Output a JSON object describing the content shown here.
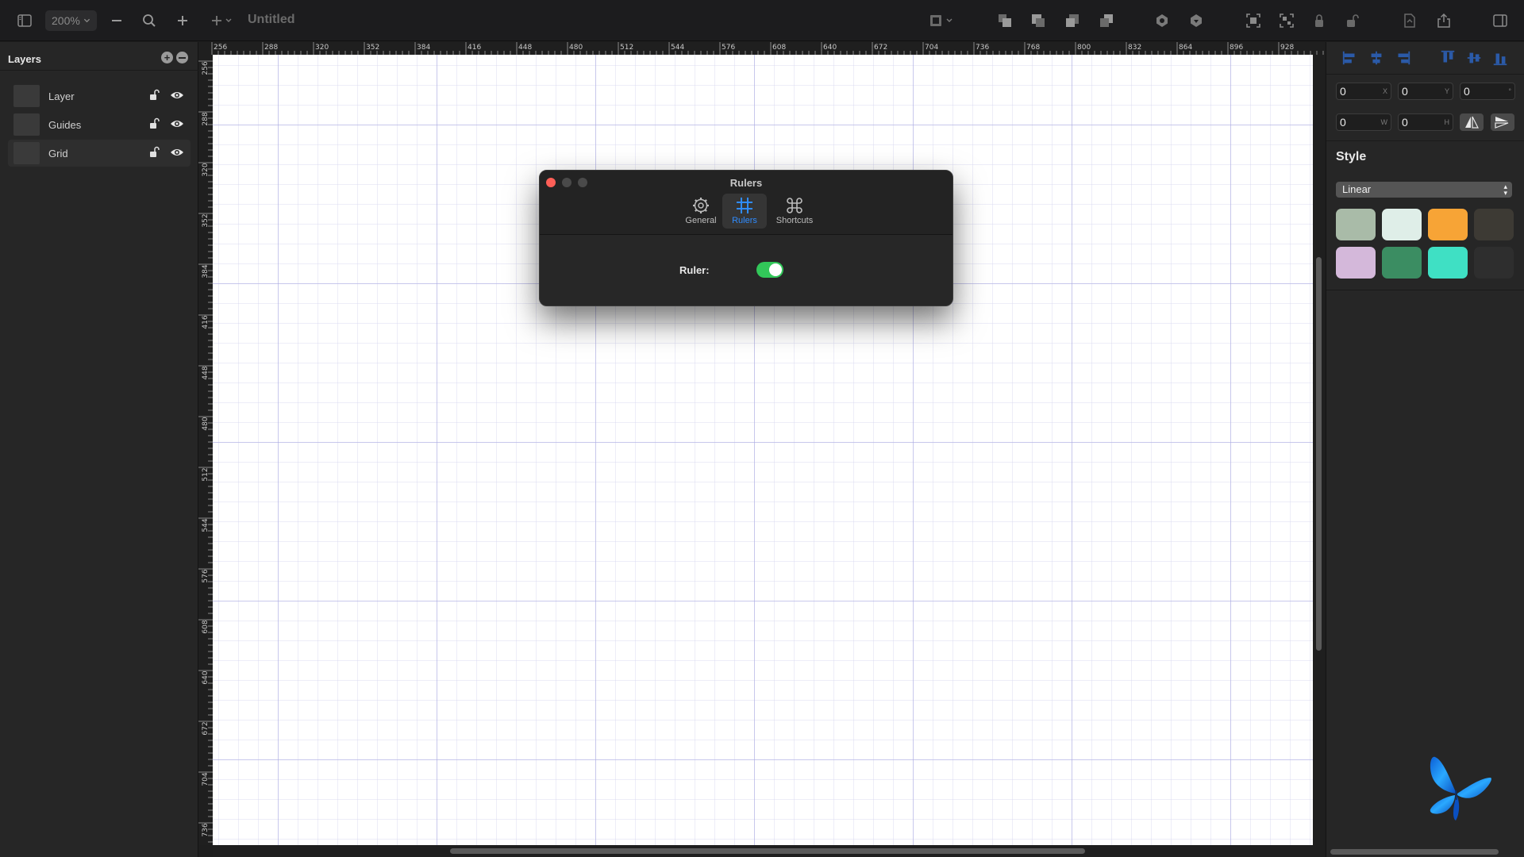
{
  "toolbar": {
    "zoom_value": "200%",
    "zoom_chevron": "⌄",
    "document_title": "Untitled",
    "icons": [
      "sidebar-left-icon",
      "zoom-out-icon",
      "magnifier-icon",
      "zoom-in-icon",
      "add-shape-icon",
      "frame-icon",
      "arrange-front-icon",
      "arrange-forward-icon",
      "arrange-backward-icon",
      "arrange-back-icon",
      "boolean-union-icon",
      "boolean-subtract-icon",
      "group-icon",
      "ungroup-icon",
      "lock-icon",
      "unlock-icon",
      "export-file-icon",
      "share-icon",
      "sidebar-right-icon"
    ]
  },
  "layers_panel": {
    "title": "Layers",
    "add_symbol": "+",
    "items": [
      {
        "name": "Layer",
        "selected": false
      },
      {
        "name": "Guides",
        "selected": false
      },
      {
        "name": "Grid",
        "selected": true
      }
    ]
  },
  "rulers": {
    "top_labels": [
      "256",
      "288",
      "320",
      "352",
      "384",
      "416",
      "448",
      "480",
      "512",
      "544",
      "576",
      "608",
      "640",
      "672",
      "704",
      "736",
      "768",
      "800",
      "832",
      "864",
      "896",
      "928"
    ],
    "left_labels": [
      "256",
      "288",
      "320",
      "352",
      "384",
      "416",
      "448",
      "480",
      "512",
      "544",
      "576",
      "608",
      "640",
      "672",
      "704",
      "736"
    ]
  },
  "dialog": {
    "title": "Rulers",
    "tabs": [
      {
        "label": "General",
        "icon": "gear-icon",
        "active": false
      },
      {
        "label": "Rulers",
        "icon": "grid-icon",
        "active": true
      },
      {
        "label": "Shortcuts",
        "icon": "command-icon",
        "active": false
      }
    ],
    "ruler_label": "Ruler:",
    "ruler_enabled": true
  },
  "inspector": {
    "fields": {
      "x": {
        "value": "0",
        "suffix": "X"
      },
      "y": {
        "value": "0",
        "suffix": "Y"
      },
      "rotation": {
        "value": "0",
        "suffix": "°"
      },
      "w": {
        "value": "0",
        "suffix": "W"
      },
      "h": {
        "value": "0",
        "suffix": "H"
      }
    },
    "style_title": "Style",
    "style_select": "Linear",
    "swatches": [
      "#a9bba8",
      "#dfeee8",
      "#f7a436",
      "#3d3a34",
      "#d4b8da",
      "#3b8d62",
      "#3fe0c4",
      "#2e2e2e"
    ]
  },
  "colors": {
    "accent": "#2f8cff",
    "toggle_on": "#32c759",
    "close_button": "#fe5f57"
  }
}
